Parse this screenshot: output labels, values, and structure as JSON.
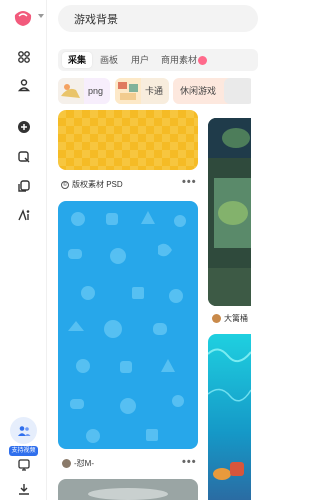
{
  "search": {
    "query": "游戏背景"
  },
  "tabs": [
    {
      "label": "采集",
      "active": true
    },
    {
      "label": "画板",
      "active": false
    },
    {
      "label": "用户",
      "active": false
    },
    {
      "label": "商用素材",
      "active": false
    }
  ],
  "chips": [
    {
      "label": "png"
    },
    {
      "label": "卡通"
    },
    {
      "label": "休闲游戏"
    }
  ],
  "cards": [
    {
      "caption": "版权素材 PSD",
      "more": "•••"
    },
    {
      "caption": "-怼M-",
      "more": "•••"
    },
    {
      "caption": "大篱桶"
    }
  ],
  "sidebar": {
    "assist_badge": "支持视频"
  },
  "colors": {
    "accent": "#2f6fed",
    "brand_pink": "#ff6a8b",
    "yellow_card": "#f5bb25",
    "blue_card": "#27a7ea"
  }
}
